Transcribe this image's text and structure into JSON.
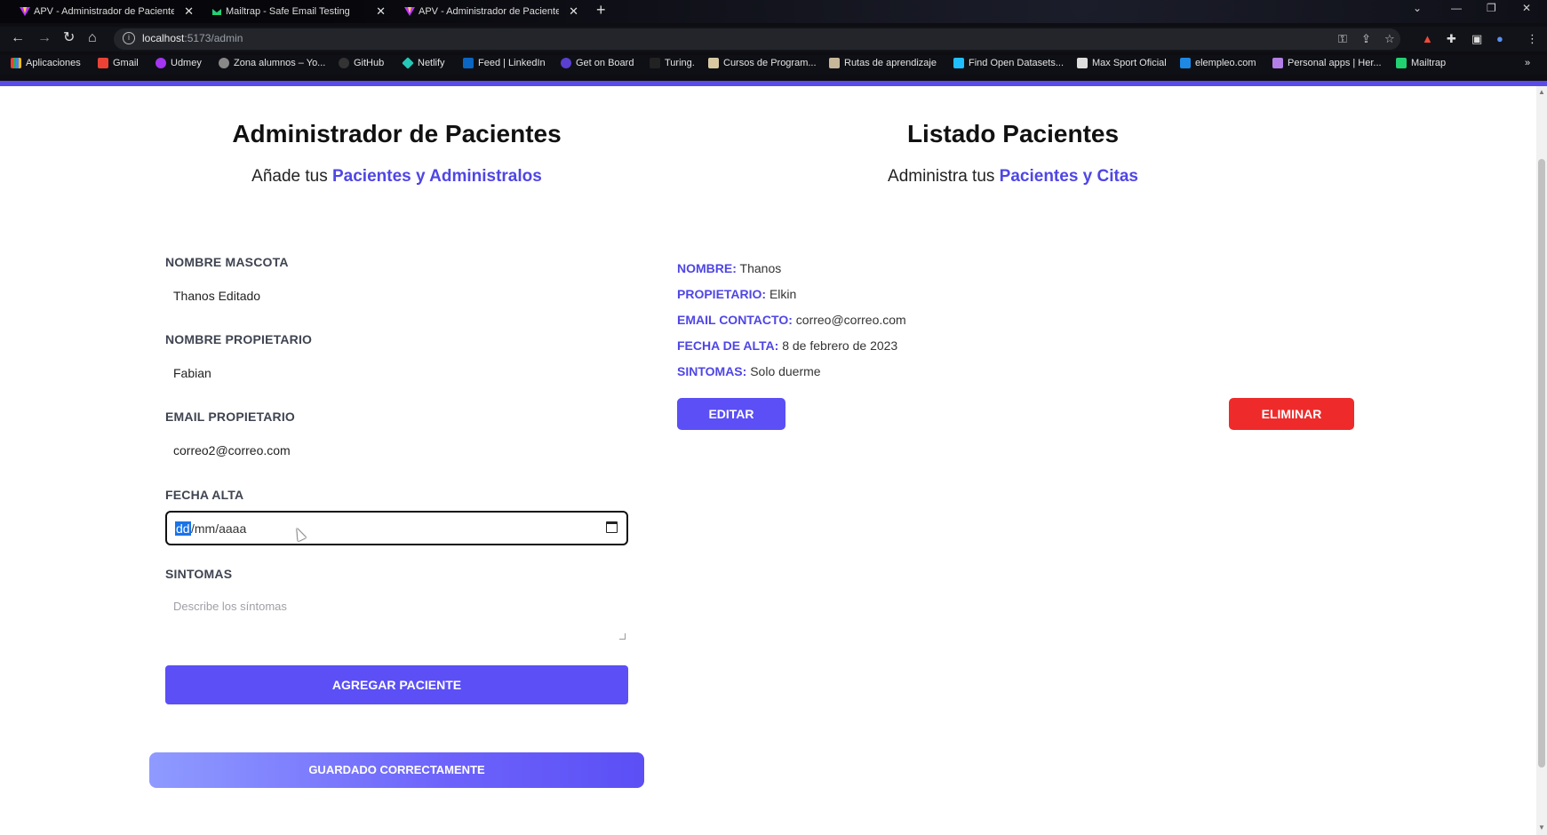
{
  "browser": {
    "tabs": [
      {
        "title": "APV - Administrador de Pacientes",
        "icon": "vite-icon"
      },
      {
        "title": "Mailtrap - Safe Email Testing",
        "icon": "mailtrap-icon"
      },
      {
        "title": "APV - Administrador de Pacientes",
        "icon": "vite-icon"
      }
    ],
    "url_host": "localhost",
    "url_path": ":5173/admin",
    "bookmarks": [
      "Aplicaciones",
      "Gmail",
      "Udmey",
      "Zona alumnos – Yo...",
      "GitHub",
      "Netlify",
      "Feed | LinkedIn",
      "Get on Board",
      "Turing.",
      "Cursos de Program...",
      "Rutas de aprendizaje",
      "Find Open Datasets...",
      "Max Sport Oficial",
      "elempleo.com",
      "Personal apps | Her...",
      "Mailtrap"
    ]
  },
  "form_panel": {
    "title": "Administrador de Pacientes",
    "subtitle_prefix": "Añade tus",
    "subtitle_accent": "Pacientes y Administralos",
    "pet_label": "NOMBRE MASCOTA",
    "pet_value": "Thanos Editado",
    "owner_label": "NOMBRE PROPIETARIO",
    "owner_value": "Fabian",
    "email_label": "EMAIL PROPIETARIO",
    "email_value": "correo2@correo.com",
    "date_label": "FECHA ALTA",
    "date_dd": "dd",
    "date_rest": "/mm/aaaa",
    "symptoms_label": "SINTOMAS",
    "symptoms_placeholder": "Describe los síntomas",
    "submit_label": "AGREGAR PACIENTE",
    "alert_text": "GUARDADO CORRECTAMENTE"
  },
  "list_panel": {
    "title": "Listado Pacientes",
    "subtitle_prefix": "Administra tus",
    "subtitle_accent": "Pacientes y Citas",
    "patient": {
      "name_key": "NOMBRE:",
      "name_value": "Thanos",
      "owner_key": "PROPIETARIO:",
      "owner_value": "Elkin",
      "email_key": "EMAIL CONTACTO:",
      "email_value": "correo@correo.com",
      "date_key": "FECHA DE ALTA:",
      "date_value": "8 de febrero de 2023",
      "symptoms_key": "SINTOMAS:",
      "symptoms_value": "Solo duerme"
    },
    "edit_label": "EDITAR",
    "delete_label": "ELIMINAR"
  },
  "colors": {
    "accent": "#4f46e5",
    "primary_button": "#5b4ff5",
    "danger_button": "#ef2a2a"
  }
}
